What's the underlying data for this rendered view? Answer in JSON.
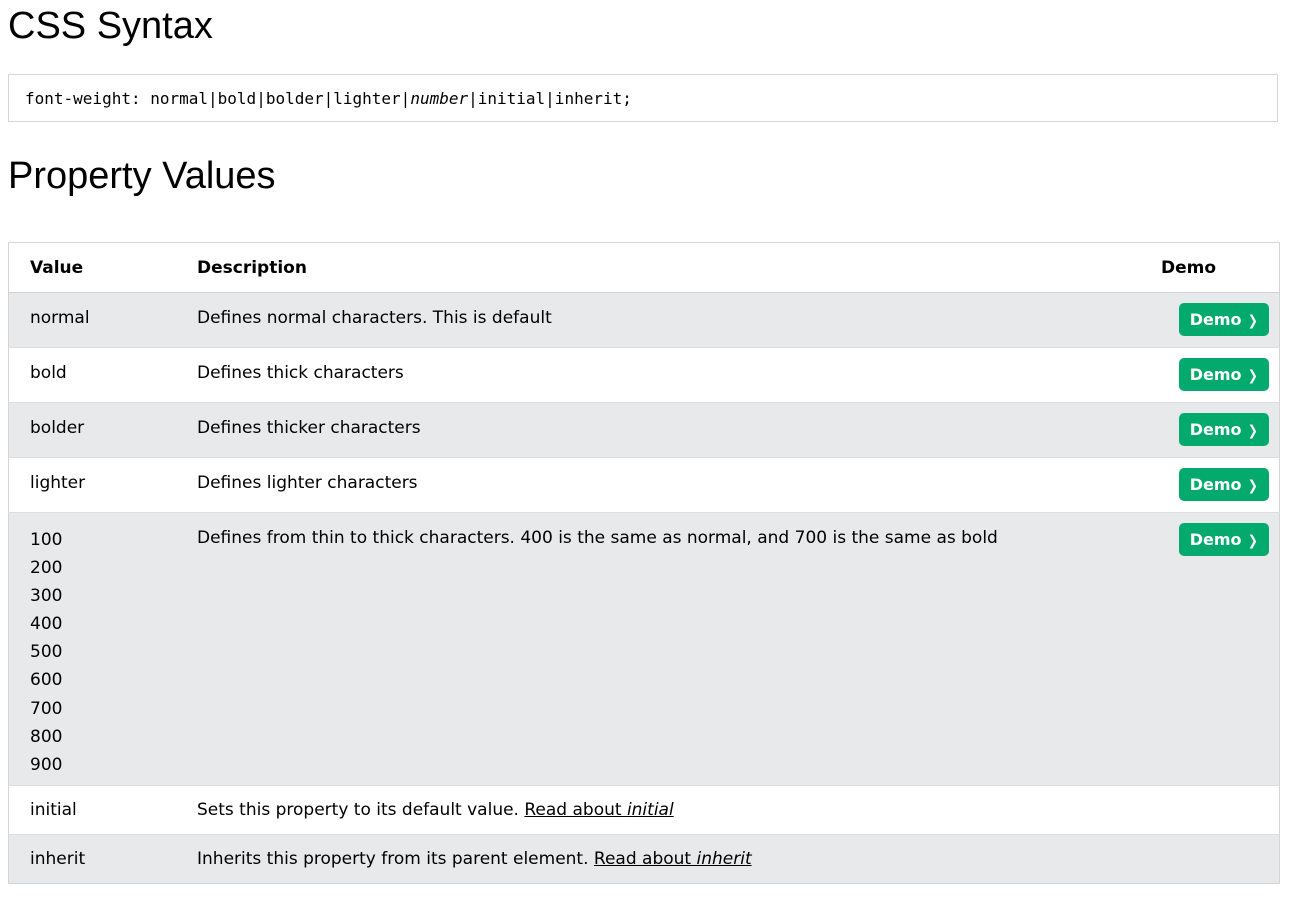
{
  "syntax": {
    "heading": "CSS Syntax",
    "code_prefix": "font-weight: normal|bold|bolder|lighter|",
    "code_italic": "number",
    "code_suffix": "|initial|inherit;"
  },
  "values": {
    "heading": "Property Values",
    "columns": {
      "value": "Value",
      "description": "Description",
      "demo": "Demo"
    },
    "demo_button_label": "Demo",
    "rows": [
      {
        "value": "normal",
        "description": "Defines normal characters. This is default",
        "has_demo": true
      },
      {
        "value": "bold",
        "description": "Defines thick characters",
        "has_demo": true
      },
      {
        "value": "bolder",
        "description": "Defines thicker characters",
        "has_demo": true
      },
      {
        "value": "lighter",
        "description": "Defines lighter characters",
        "has_demo": true
      },
      {
        "values": [
          "100",
          "200",
          "300",
          "400",
          "500",
          "600",
          "700",
          "800",
          "900"
        ],
        "description": "Defines from thin to thick characters. 400 is the same as normal, and 700 is the same as bold",
        "has_demo": true
      },
      {
        "value": "initial",
        "description": "Sets this property to its default value. ",
        "link_text": "Read about ",
        "link_italic": "initial",
        "has_demo": false
      },
      {
        "value": "inherit",
        "description": "Inherits this property from its parent element. ",
        "link_text": "Read about ",
        "link_italic": "inherit",
        "has_demo": false
      }
    ]
  },
  "colors": {
    "demo_button": "#04aa6d",
    "row_alt": "#e7e9eb",
    "border": "#d4d4d4"
  },
  "icons": {
    "demo_chevron": "chevron-right-icon"
  }
}
